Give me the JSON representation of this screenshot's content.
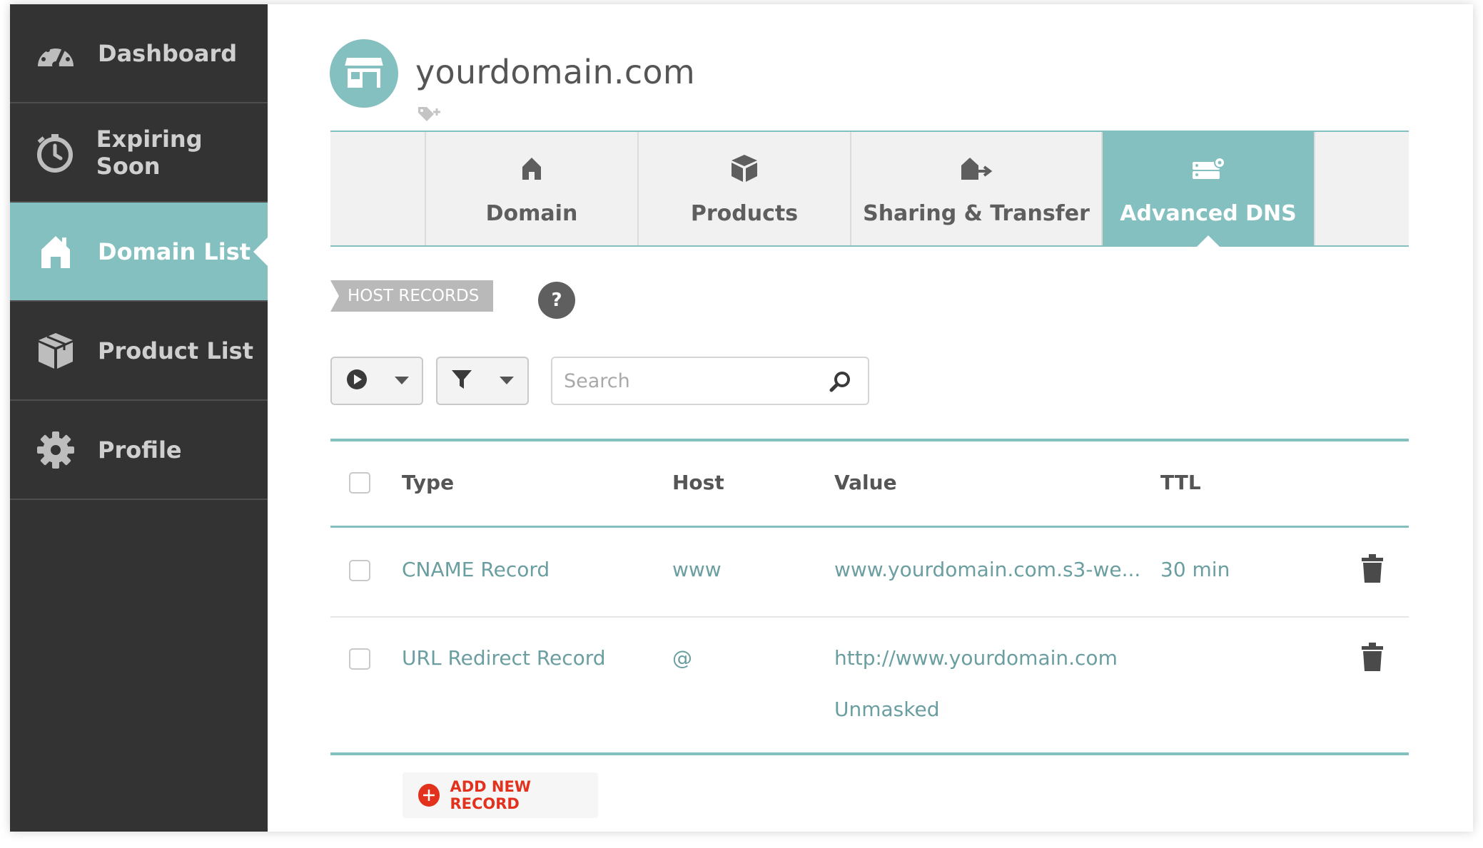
{
  "sidebar": {
    "items": [
      {
        "label": "Dashboard",
        "icon": "dashboard-gauge-icon"
      },
      {
        "label": "Expiring Soon",
        "icon": "stopwatch-icon"
      },
      {
        "label": "Domain List",
        "icon": "house-icon",
        "active": true
      },
      {
        "label": "Product List",
        "icon": "box-icon"
      },
      {
        "label": "Profile",
        "icon": "gear-icon"
      }
    ]
  },
  "header": {
    "domain": "yourdomain.com",
    "avatar_icon": "storefront-icon",
    "tag_icon": "add-tag-icon"
  },
  "tabs": [
    {
      "label": "",
      "icon": ""
    },
    {
      "label": "Domain",
      "icon": "house-icon"
    },
    {
      "label": "Products",
      "icon": "box-icon"
    },
    {
      "label": "Sharing & Transfer",
      "icon": "house-transfer-icon"
    },
    {
      "label": "Advanced DNS",
      "icon": "server-gear-icon",
      "active": true
    },
    {
      "label": "",
      "icon": ""
    }
  ],
  "section": {
    "label": "HOST RECORDS",
    "help": "?"
  },
  "toolbar": {
    "actions_icon": "play-circle-icon",
    "filter_icon": "filter-icon",
    "search_placeholder": "Search",
    "search_value": ""
  },
  "table": {
    "columns": [
      "Type",
      "Host",
      "Value",
      "TTL"
    ],
    "rows": [
      {
        "type": "CNAME Record",
        "host": "www",
        "value": "www.yourdomain.com.s3-we...",
        "ttl": "30 min"
      },
      {
        "type": "URL Redirect Record",
        "host": "@",
        "value": "http://www.yourdomain.com",
        "value_extra": "Unmasked",
        "ttl": ""
      }
    ]
  },
  "add_button": {
    "label": "ADD NEW RECORD"
  },
  "colors": {
    "accent": "#84c0bf",
    "sidebar_bg": "#333333",
    "danger": "#e2311d"
  }
}
